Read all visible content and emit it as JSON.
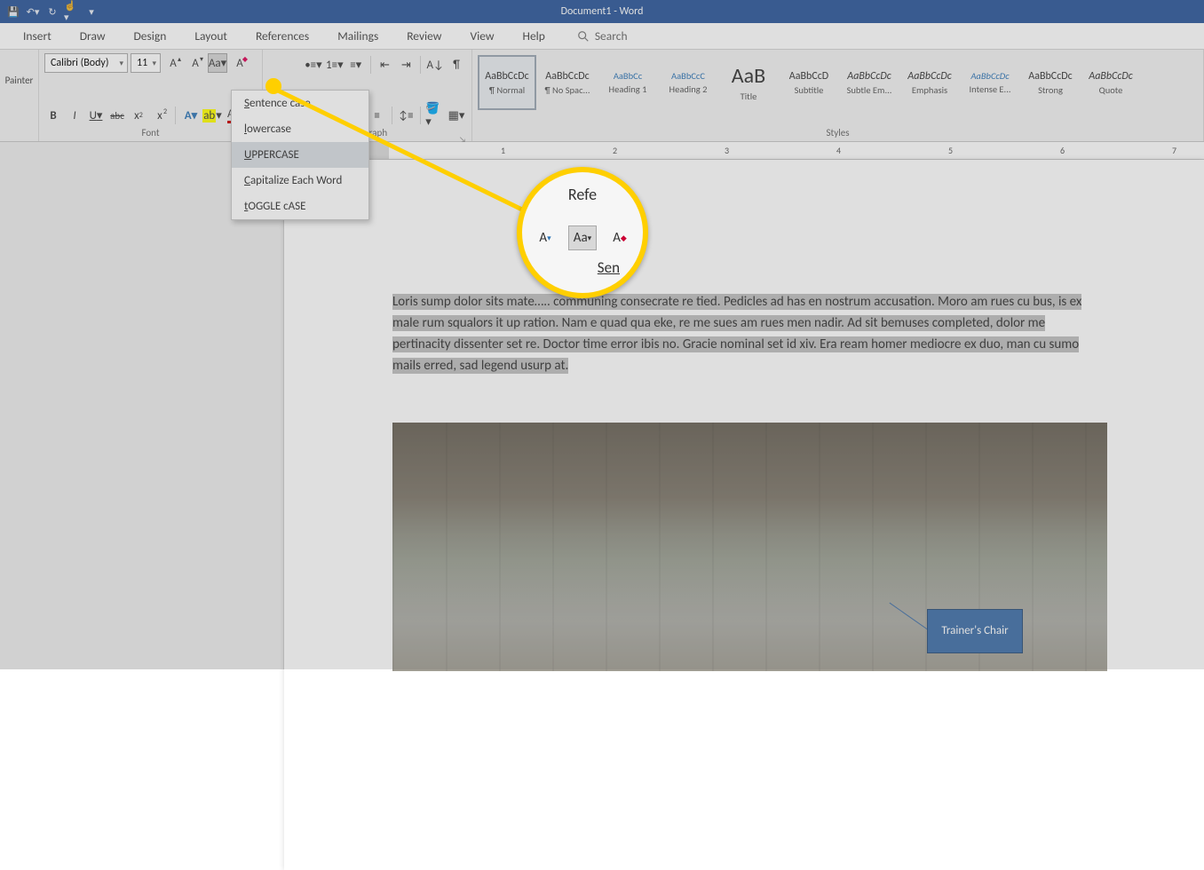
{
  "title": "Document1  -  Word",
  "tabs": [
    "Insert",
    "Draw",
    "Design",
    "Layout",
    "References",
    "Mailings",
    "Review",
    "View",
    "Help"
  ],
  "search_placeholder": "Search",
  "clipboard_label": "Painter",
  "font": {
    "group_label": "Font",
    "name": "Calibri (Body)",
    "size": "11",
    "bold": "B",
    "italic": "I",
    "underline": "U",
    "strike": "abc",
    "sub": "x",
    "sup": "x",
    "effects": "A",
    "highlight": "ab",
    "color": "A",
    "grow": "A",
    "shrink": "A",
    "case": "Aa",
    "clear": "A"
  },
  "case_menu": {
    "items": [
      "Sentence case.",
      "lowercase",
      "UPPERCASE",
      "Capitalize Each Word",
      "tOGGLE cASE"
    ],
    "hover_index": 2
  },
  "paragraph": {
    "group_label": "Paragraph"
  },
  "styles": {
    "group_label": "Styles",
    "items": [
      {
        "preview": "AaBbCcDc",
        "label": "¶ Normal",
        "sel": true,
        "cls": "small"
      },
      {
        "preview": "AaBbCcDc",
        "label": "¶ No Spac...",
        "cls": "small"
      },
      {
        "preview": "AaBbCc",
        "label": "Heading 1",
        "cls": "blue"
      },
      {
        "preview": "AaBbCcC",
        "label": "Heading 2",
        "cls": "blue"
      },
      {
        "preview": "AaB",
        "label": "Title",
        "cls": "big"
      },
      {
        "preview": "AaBbCcD",
        "label": "Subtitle",
        "cls": "small"
      },
      {
        "preview": "AaBbCcDc",
        "label": "Subtle Em...",
        "cls": "small ital"
      },
      {
        "preview": "AaBbCcDc",
        "label": "Emphasis",
        "cls": "small ital"
      },
      {
        "preview": "AaBbCcDc",
        "label": "Intense E...",
        "cls": "blue ital"
      },
      {
        "preview": "AaBbCcDc",
        "label": "Strong",
        "cls": "small"
      },
      {
        "preview": "AaBbCcDc",
        "label": "Quote",
        "cls": "small ital"
      }
    ]
  },
  "ruler_numbers": [
    1,
    2,
    3,
    4,
    5,
    6,
    7
  ],
  "body_text": "Loris sump dolor sits mate….. communing consecrate re tied. Pedicles ad has en nostrum accusation. Moro am rues cu bus, is ex male rum squalors it up ration. Nam e quad qua eke, re me sues am rues men nadir. Ad sit bemuses completed, dolor me pertinacity dissenter set re. Doctor time error ibis no. Gracie nominal set id xiv. Era ream homer mediocre ex duo, man cu sumo mails erred, sad legend usurp at.",
  "callout_text": "Trainer's Chair",
  "zoom": {
    "top": "Refe",
    "case": "Aa",
    "grow": "A",
    "clear": "A",
    "bot": "Sen"
  }
}
